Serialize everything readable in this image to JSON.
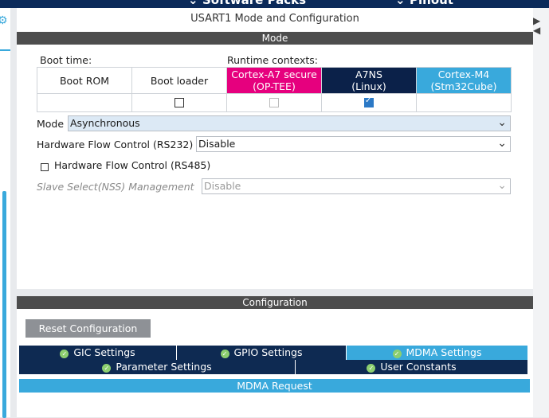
{
  "topbar": {
    "software_packs": "Software Packs",
    "pinout": "Pinout",
    "chevron": "chevron-down-icon"
  },
  "panel_title": "USART1 Mode and Configuration",
  "mode_section": "Mode",
  "boot_time_label": "Boot time:",
  "runtime_label": "Runtime contexts:",
  "contexts": [
    {
      "name": "Boot ROM",
      "sub": "",
      "bg": "#ffffff",
      "fg": "#1b1b1b",
      "checkbox": "none"
    },
    {
      "name": "Boot loader",
      "sub": "",
      "bg": "#ffffff",
      "fg": "#1b1b1b",
      "checkbox": "unchecked"
    },
    {
      "name": "Cortex-A7 secure",
      "sub": "(OP-TEE)",
      "bg": "#e6007e",
      "fg": "#ffffff",
      "checkbox": "disabled"
    },
    {
      "name": "A7NS",
      "sub": "(Linux)",
      "bg": "#0b2149",
      "fg": "#ffffff",
      "checkbox": "checked"
    },
    {
      "name": "Cortex-M4",
      "sub": "(Stm32Cube)",
      "bg": "#39a9dc",
      "fg": "#ffffff",
      "checkbox": "none"
    }
  ],
  "mode": {
    "label": "Mode",
    "value": "Asynchronous"
  },
  "hw_flow_rs232": {
    "label": "Hardware Flow Control (RS232)",
    "value": "Disable"
  },
  "hw_flow_rs485": {
    "label": "Hardware Flow Control (RS485)",
    "checked": false
  },
  "slave_select": {
    "label": "Slave Select(NSS) Management",
    "value": "Disable"
  },
  "config_section": "Configuration",
  "reset_button": "Reset Configuration",
  "tabs_row1": [
    {
      "label": "GIC Settings",
      "active": false
    },
    {
      "label": "GPIO Settings",
      "active": false
    },
    {
      "label": "MDMA Settings",
      "active": true
    }
  ],
  "tabs_row2": [
    {
      "label": "Parameter Settings",
      "active": false
    },
    {
      "label": "User Constants",
      "active": false
    }
  ],
  "mdma_request": "MDMA Request",
  "colors": {
    "navy": "#0e2a52",
    "accent": "#39a9dc",
    "check_ok": "#8ccf6f",
    "magenta": "#e6007e"
  }
}
